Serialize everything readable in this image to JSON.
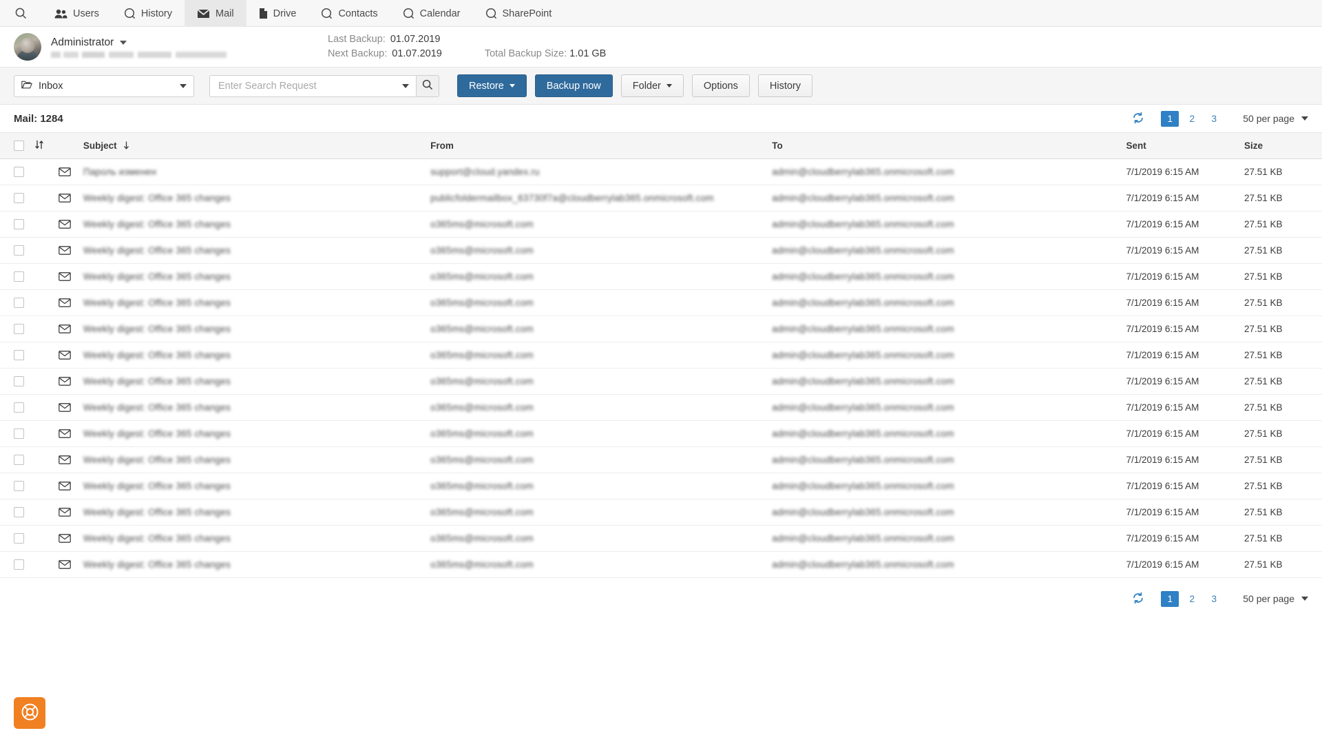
{
  "nav": {
    "search_icon_label": "search-icon",
    "items": [
      {
        "label": "Users",
        "icon": "users-icon",
        "active": false
      },
      {
        "label": "History",
        "icon": "history-icon",
        "active": false
      },
      {
        "label": "Mail",
        "icon": "mail-icon",
        "active": true
      },
      {
        "label": "Drive",
        "icon": "file-icon",
        "active": false
      },
      {
        "label": "Contacts",
        "icon": "contacts-icon",
        "active": false
      },
      {
        "label": "Calendar",
        "icon": "calendar-icon",
        "active": false
      },
      {
        "label": "SharePoint",
        "icon": "sharepoint-icon",
        "active": false
      }
    ]
  },
  "profile": {
    "name": "Administrator",
    "email_redacted": ""
  },
  "backup": {
    "last_label": "Last Backup:",
    "last_value": "01.07.2019",
    "next_label": "Next Backup:",
    "next_value": "01.07.2019",
    "total_label": "Total Backup Size:",
    "total_value": "1.01 GB"
  },
  "toolbar": {
    "folder_value": "Inbox",
    "search_placeholder": "Enter Search Request",
    "search_value": "",
    "restore_label": "Restore",
    "backup_now_label": "Backup now",
    "folder_label": "Folder",
    "options_label": "Options",
    "history_label": "History"
  },
  "list": {
    "count_label": "Mail: 1284",
    "per_page": "50 per page",
    "pages": [
      "1",
      "2",
      "3"
    ],
    "active_page": "1"
  },
  "table": {
    "headers": {
      "subject": "Subject",
      "from": "From",
      "to": "To",
      "sent": "Sent",
      "size": "Size"
    },
    "sort_column": "Subject",
    "sort_direction": "desc",
    "rows": [
      {
        "subject": "Пароль изменен",
        "from": "support@cloud.yandex.ru",
        "to": "admin@cloudberrylab365.onmicrosoft.com",
        "sent": "7/1/2019 6:15 AM",
        "size": "27.51 KB"
      },
      {
        "subject": "Weekly digest: Office 365 changes",
        "from": "publicfoldermailbox_63730f7a@cloudberrylab365.onmicrosoft.com",
        "to": "admin@cloudberrylab365.onmicrosoft.com",
        "sent": "7/1/2019 6:15 AM",
        "size": "27.51 KB"
      },
      {
        "subject": "Weekly digest: Office 365 changes",
        "from": "o365ms@microsoft.com",
        "to": "admin@cloudberrylab365.onmicrosoft.com",
        "sent": "7/1/2019 6:15 AM",
        "size": "27.51 KB"
      },
      {
        "subject": "Weekly digest: Office 365 changes",
        "from": "o365ms@microsoft.com",
        "to": "admin@cloudberrylab365.onmicrosoft.com",
        "sent": "7/1/2019 6:15 AM",
        "size": "27.51 KB"
      },
      {
        "subject": "Weekly digest: Office 365 changes",
        "from": "o365ms@microsoft.com",
        "to": "admin@cloudberrylab365.onmicrosoft.com",
        "sent": "7/1/2019 6:15 AM",
        "size": "27.51 KB"
      },
      {
        "subject": "Weekly digest: Office 365 changes",
        "from": "o365ms@microsoft.com",
        "to": "admin@cloudberrylab365.onmicrosoft.com",
        "sent": "7/1/2019 6:15 AM",
        "size": "27.51 KB"
      },
      {
        "subject": "Weekly digest: Office 365 changes",
        "from": "o365ms@microsoft.com",
        "to": "admin@cloudberrylab365.onmicrosoft.com",
        "sent": "7/1/2019 6:15 AM",
        "size": "27.51 KB"
      },
      {
        "subject": "Weekly digest: Office 365 changes",
        "from": "o365ms@microsoft.com",
        "to": "admin@cloudberrylab365.onmicrosoft.com",
        "sent": "7/1/2019 6:15 AM",
        "size": "27.51 KB"
      },
      {
        "subject": "Weekly digest: Office 365 changes",
        "from": "o365ms@microsoft.com",
        "to": "admin@cloudberrylab365.onmicrosoft.com",
        "sent": "7/1/2019 6:15 AM",
        "size": "27.51 KB"
      },
      {
        "subject": "Weekly digest: Office 365 changes",
        "from": "o365ms@microsoft.com",
        "to": "admin@cloudberrylab365.onmicrosoft.com",
        "sent": "7/1/2019 6:15 AM",
        "size": "27.51 KB"
      },
      {
        "subject": "Weekly digest: Office 365 changes",
        "from": "o365ms@microsoft.com",
        "to": "admin@cloudberrylab365.onmicrosoft.com",
        "sent": "7/1/2019 6:15 AM",
        "size": "27.51 KB"
      },
      {
        "subject": "Weekly digest: Office 365 changes",
        "from": "o365ms@microsoft.com",
        "to": "admin@cloudberrylab365.onmicrosoft.com",
        "sent": "7/1/2019 6:15 AM",
        "size": "27.51 KB"
      },
      {
        "subject": "Weekly digest: Office 365 changes",
        "from": "o365ms@microsoft.com",
        "to": "admin@cloudberrylab365.onmicrosoft.com",
        "sent": "7/1/2019 6:15 AM",
        "size": "27.51 KB"
      },
      {
        "subject": "Weekly digest: Office 365 changes",
        "from": "o365ms@microsoft.com",
        "to": "admin@cloudberrylab365.onmicrosoft.com",
        "sent": "7/1/2019 6:15 AM",
        "size": "27.51 KB"
      },
      {
        "subject": "Weekly digest: Office 365 changes",
        "from": "o365ms@microsoft.com",
        "to": "admin@cloudberrylab365.onmicrosoft.com",
        "sent": "7/1/2019 6:15 AM",
        "size": "27.51 KB"
      },
      {
        "subject": "Weekly digest: Office 365 changes",
        "from": "o365ms@microsoft.com",
        "to": "admin@cloudberrylab365.onmicrosoft.com",
        "sent": "7/1/2019 6:15 AM",
        "size": "27.51 KB"
      }
    ]
  },
  "colors": {
    "primary": "#2f6a9c",
    "link": "#3a7fb5",
    "page_active": "#2f80c4",
    "help_fab": "#f08021",
    "toolbar_bg": "#f5f5f5",
    "nav_bg": "#f7f7f7"
  }
}
